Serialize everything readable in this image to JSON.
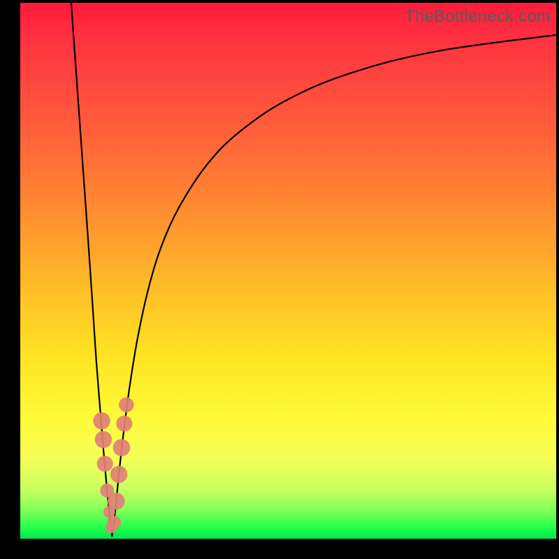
{
  "watermark": "TheBottleneck.com",
  "colors": {
    "curve_stroke": "#000000",
    "marker_fill": "#e08076",
    "gradient_top": "#ff1a3a",
    "gradient_bottom": "#00e84e",
    "frame": "#000000"
  },
  "chart_data": {
    "type": "line",
    "title": "",
    "xlabel": "",
    "ylabel": "",
    "xlim": [
      0,
      100
    ],
    "ylim": [
      0,
      100
    ],
    "grid": false,
    "legend": false,
    "notes": "V-shaped curve: steep descent from top-left to a sharp minimum near x≈17, then asymptotic rise toward ~94 at right edge. Pink rounded markers clustered near the minimum on both branches.",
    "series": [
      {
        "name": "left-branch",
        "x": [
          9.5,
          10.5,
          11.5,
          12.5,
          13.4,
          14.2,
          15.0,
          15.7,
          16.3,
          16.8,
          17.1
        ],
        "values": [
          100.0,
          86.0,
          72.0,
          58.0,
          45.0,
          33.0,
          23.0,
          14.5,
          8.0,
          3.5,
          0.5
        ]
      },
      {
        "name": "right-branch",
        "x": [
          17.1,
          17.7,
          18.4,
          19.3,
          20.5,
          22.0,
          24.0,
          26.5,
          30.0,
          35.0,
          41.0,
          50.0,
          62.0,
          78.0,
          100.0
        ],
        "values": [
          0.5,
          5.0,
          12.0,
          20.0,
          29.0,
          38.0,
          47.0,
          55.0,
          62.5,
          70.0,
          76.0,
          82.0,
          87.0,
          91.0,
          94.0
        ]
      }
    ],
    "markers": [
      {
        "branch": "left",
        "x": 15.2,
        "y": 22.0,
        "r": 1.6
      },
      {
        "branch": "left",
        "x": 15.5,
        "y": 18.5,
        "r": 1.6
      },
      {
        "branch": "left",
        "x": 15.8,
        "y": 14.0,
        "r": 1.5
      },
      {
        "branch": "left",
        "x": 16.2,
        "y": 9.0,
        "r": 1.3
      },
      {
        "branch": "left",
        "x": 16.6,
        "y": 5.0,
        "r": 1.1
      },
      {
        "branch": "left",
        "x": 16.9,
        "y": 2.0,
        "r": 1.0
      },
      {
        "branch": "right",
        "x": 17.5,
        "y": 3.0,
        "r": 1.3
      },
      {
        "branch": "right",
        "x": 17.9,
        "y": 7.0,
        "r": 1.6
      },
      {
        "branch": "right",
        "x": 18.4,
        "y": 12.0,
        "r": 1.6
      },
      {
        "branch": "right",
        "x": 18.9,
        "y": 17.0,
        "r": 1.6
      },
      {
        "branch": "right",
        "x": 19.4,
        "y": 21.5,
        "r": 1.5
      },
      {
        "branch": "right",
        "x": 19.8,
        "y": 25.0,
        "r": 1.4
      }
    ]
  }
}
